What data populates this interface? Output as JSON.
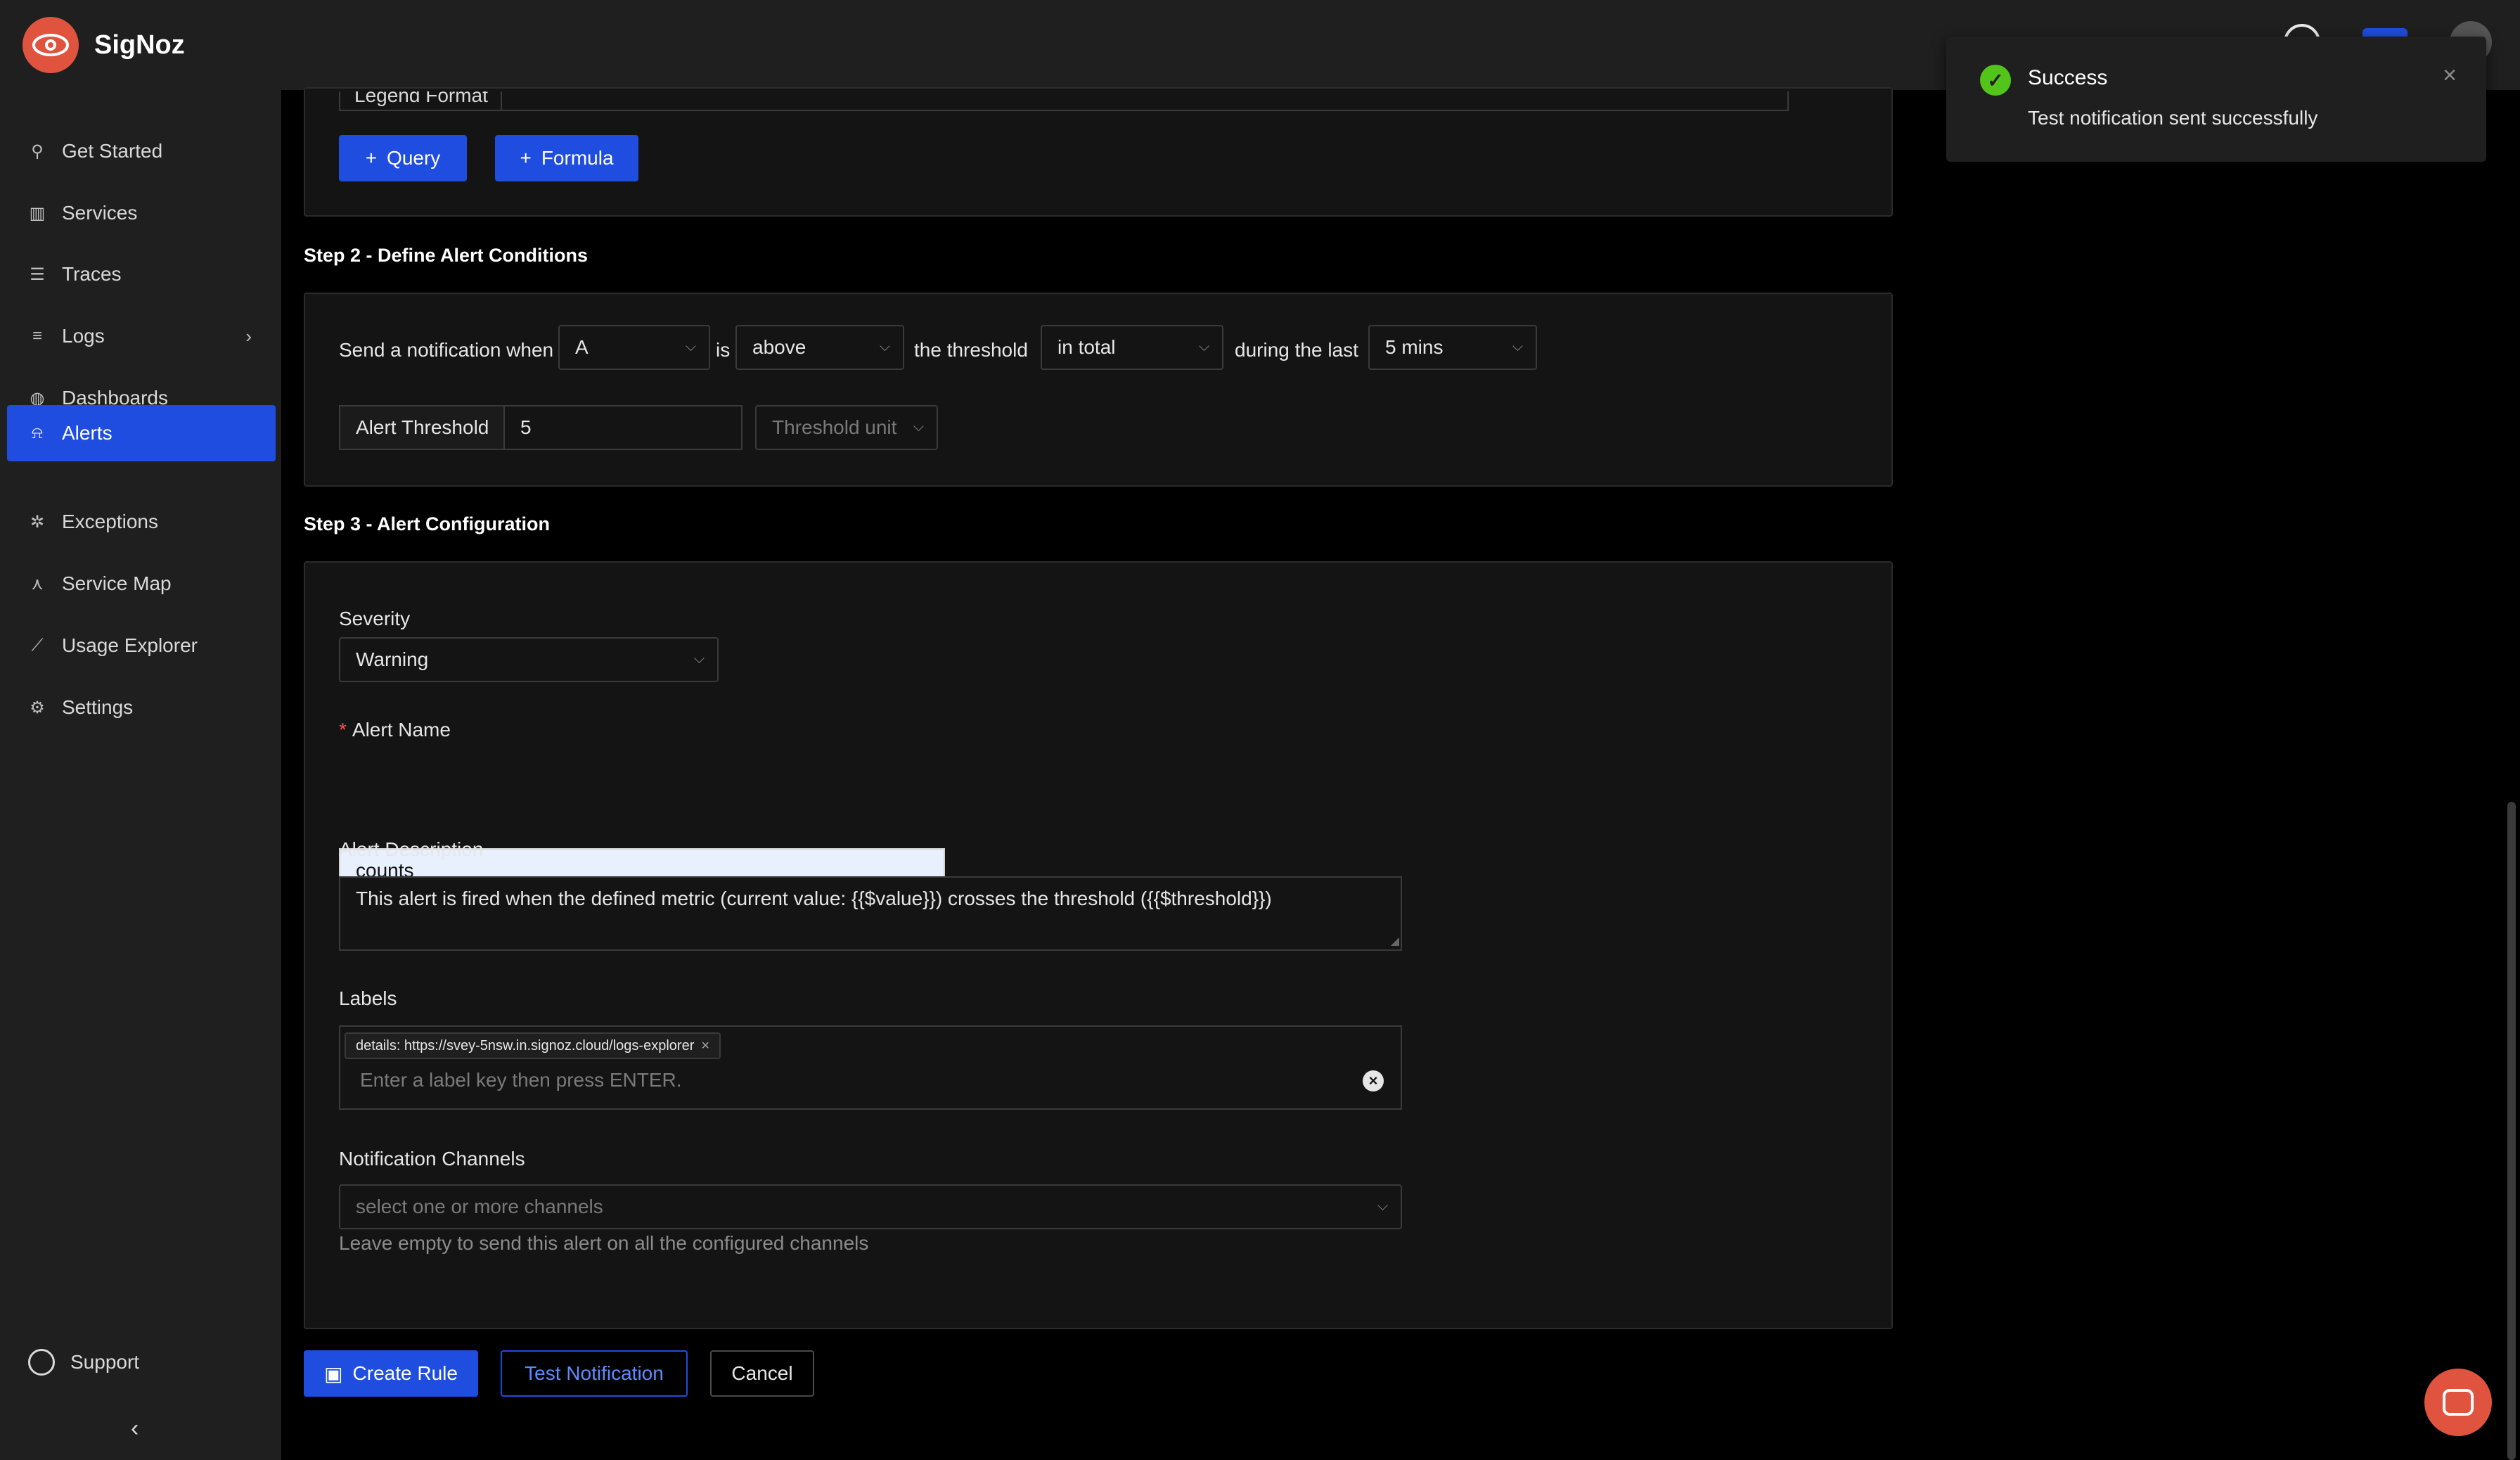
{
  "app": {
    "name": "SigNoz"
  },
  "sidebar": {
    "items": [
      {
        "label": "Get Started",
        "icon": "rocket-icon"
      },
      {
        "label": "Services",
        "icon": "bar-chart-icon"
      },
      {
        "label": "Traces",
        "icon": "list-icon"
      },
      {
        "label": "Logs",
        "icon": "logs-icon"
      },
      {
        "label": "Dashboards",
        "icon": "dashboard-icon"
      },
      {
        "label": "Alerts",
        "icon": "bell-icon"
      },
      {
        "label": "Exceptions",
        "icon": "bug-icon"
      },
      {
        "label": "Service Map",
        "icon": "share-icon"
      },
      {
        "label": "Usage Explorer",
        "icon": "line-chart-icon"
      },
      {
        "label": "Settings",
        "icon": "gear-icon"
      }
    ],
    "active": "Alerts",
    "support_label": "Support"
  },
  "query_section": {
    "legend_label": "Legend Format",
    "query_button": "Query",
    "formula_button": "Formula"
  },
  "step2": {
    "title": "Step 2 - Define Alert Conditions",
    "send_text": "Send a notification when",
    "query_select": "A",
    "is_text": "is",
    "op_select": "above",
    "threshold_text": "the threshold",
    "match_select": "in total",
    "during_text": "during the last",
    "window_select": "5 mins",
    "threshold_label": "Alert Threshold",
    "threshold_value": "5",
    "unit_placeholder": "Threshold unit"
  },
  "step3": {
    "title": "Step 3 - Alert Configuration",
    "severity_label": "Severity",
    "severity_value": "Warning",
    "name_required": "*",
    "name_label": "Alert Name",
    "name_value": "counts",
    "description_label": "Alert Description",
    "description_value": "This alert is fired when the defined metric (current value: {{$value}}) crosses the threshold ({{$threshold}})",
    "labels_label": "Labels",
    "label_tag": "details: https://svey-5nsw.in.signoz.cloud/logs-explorer",
    "labels_placeholder": "Enter a label key then press ENTER.",
    "channels_label": "Notification Channels",
    "channels_placeholder": "select one or more channels",
    "channels_help": "Leave empty to send this alert on all the configured channels"
  },
  "actions": {
    "create": "Create Rule",
    "test": "Test Notification",
    "cancel": "Cancel"
  },
  "toast": {
    "title": "Success",
    "message": "Test notification sent successfully"
  },
  "colors": {
    "primary": "#1f4de0",
    "brand": "#e0533f",
    "success": "#52c41a"
  }
}
